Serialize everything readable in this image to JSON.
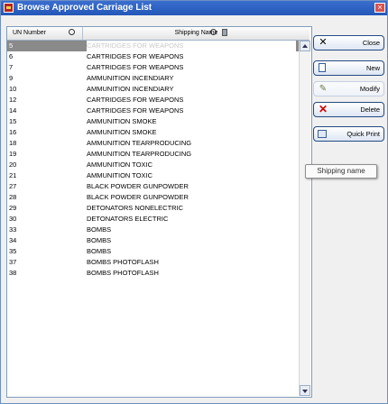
{
  "window": {
    "title": "Browse Approved Carriage List"
  },
  "columns": {
    "un_number": "UN Number",
    "shipping_name": "Shipping Name"
  },
  "rows": [
    {
      "un": "5",
      "name": "CARTRIDGES FOR WEAPONS",
      "selected": true
    },
    {
      "un": "6",
      "name": "CARTRIDGES FOR WEAPONS"
    },
    {
      "un": "7",
      "name": "CARTRIDGES FOR WEAPONS"
    },
    {
      "un": "9",
      "name": "AMMUNITION INCENDIARY"
    },
    {
      "un": "10",
      "name": "AMMUNITION INCENDIARY"
    },
    {
      "un": "12",
      "name": "CARTRIDGES FOR WEAPONS"
    },
    {
      "un": "14",
      "name": "CARTRIDGES FOR WEAPONS"
    },
    {
      "un": "15",
      "name": "AMMUNITION SMOKE"
    },
    {
      "un": "16",
      "name": "AMMUNITION SMOKE"
    },
    {
      "un": "18",
      "name": "AMMUNITION TEARPRODUCING"
    },
    {
      "un": "19",
      "name": "AMMUNITION TEARPRODUCING"
    },
    {
      "un": "20",
      "name": "AMMUNITION TOXIC"
    },
    {
      "un": "21",
      "name": "AMMUNITION TOXIC"
    },
    {
      "un": "27",
      "name": "BLACK POWDER GUNPOWDER"
    },
    {
      "un": "28",
      "name": "BLACK POWDER GUNPOWDER"
    },
    {
      "un": "29",
      "name": "DETONATORS NONELECTRIC"
    },
    {
      "un": "30",
      "name": "DETONATORS ELECTRIC"
    },
    {
      "un": "33",
      "name": "BOMBS"
    },
    {
      "un": "34",
      "name": "BOMBS"
    },
    {
      "un": "35",
      "name": "BOMBS"
    },
    {
      "un": "37",
      "name": "BOMBS PHOTOFLASH"
    },
    {
      "un": "38",
      "name": "BOMBS PHOTOFLASH"
    }
  ],
  "buttons": {
    "close": "Close",
    "new": "New",
    "modify": "Modify",
    "delete": "Delete",
    "quick_print": "Quick Print"
  },
  "tooltip": "Shipping name",
  "icons": {
    "app": "app-icon",
    "sort": "sort-icon",
    "lock": "lock-icon",
    "close": "close-x-icon",
    "new": "new-document-icon",
    "modify": "edit-pencil-icon",
    "delete": "delete-x-icon",
    "print": "printer-icon"
  },
  "colors": {
    "title_bar": "#2458b8",
    "selected_row": "#8a8a8a",
    "delete_icon": "#d00000"
  }
}
